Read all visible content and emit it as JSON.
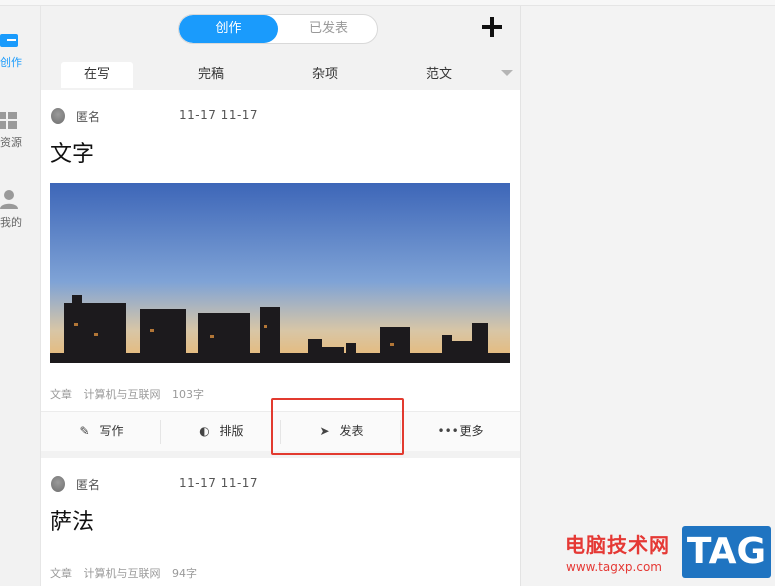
{
  "sidebar": {
    "items": [
      {
        "label": "创作",
        "icon": "pen-square-icon",
        "active": true
      },
      {
        "label": "资源",
        "icon": "grid-icon",
        "active": false
      },
      {
        "label": "我的",
        "icon": "person-icon",
        "active": false
      }
    ]
  },
  "header": {
    "toggle": {
      "active": "创作",
      "inactive": "已发表"
    },
    "add": "+"
  },
  "subtabs": [
    "在写",
    "完稿",
    "杂项",
    "范文"
  ],
  "posts": [
    {
      "author": "匿名",
      "date": "11-17   11-17",
      "title": "文字",
      "meta": [
        "文章",
        "计算机与互联网",
        "103字"
      ],
      "actions": [
        {
          "icon": "pencil-icon",
          "label": "写作"
        },
        {
          "icon": "layout-icon",
          "label": "排版"
        },
        {
          "icon": "send-icon",
          "label": "发表"
        },
        {
          "icon": "more-icon",
          "label": "更多"
        }
      ]
    },
    {
      "author": "匿名",
      "date": "11-17   11-17",
      "title": "萨法",
      "meta": [
        "文章",
        "计算机与互联网",
        "94字"
      ]
    }
  ],
  "watermark": {
    "site_cn": "电脑技术网",
    "site_url": "www.tagxp.com",
    "tag": "TAG"
  },
  "colors": {
    "accent": "#1a9bfc",
    "highlight": "#e23a2f",
    "watermark_red": "#e53935",
    "watermark_blue": "#1f74c1"
  }
}
